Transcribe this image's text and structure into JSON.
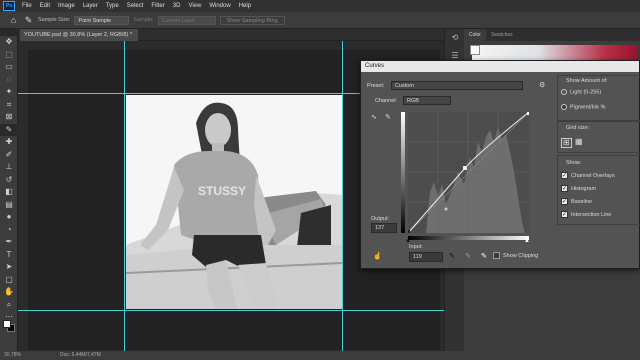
{
  "menubar": {
    "logo": "Ps",
    "items": [
      "File",
      "Edit",
      "Image",
      "Layer",
      "Type",
      "Select",
      "Filter",
      "3D",
      "View",
      "Window",
      "Help"
    ]
  },
  "options": {
    "sample_size_label": "Sample Size:",
    "sample_size_value": "Point Sample",
    "sample_label": "Sample:",
    "sample_value": "Current Layer",
    "show_ring": "Show Sampling Ring"
  },
  "document": {
    "tab_title": "YOUTUBE.psd @ 30,8% (Layer 2, RGB/8) *",
    "close": "×"
  },
  "status": {
    "zoom": "30,78%",
    "doc": "Doc: 6,44M/7,47M"
  },
  "panels": {
    "tabs": [
      "Color",
      "Swatches"
    ]
  },
  "curves": {
    "title": "Curves",
    "preset_label": "Preset:",
    "preset_value": "Custom",
    "channel_label": "Channel:",
    "channel_value": "RGB",
    "output_label": "Output:",
    "output_value": "137",
    "input_label": "Input:",
    "input_value": "119",
    "show_clipping": "Show Clipping",
    "show_amount_label": "Show Amount of:",
    "light_option": "Light  (0-255)",
    "pigment_option": "Pigment/Ink %",
    "grid_size_label": "Grid size:",
    "show_label": "Show:",
    "show_options": [
      "Channel Overlays",
      "Histogram",
      "Baseline",
      "Intersection Line"
    ]
  },
  "icons": {
    "toolbar": [
      "move-icon",
      "artboard-icon",
      "marquee-icon",
      "lasso-icon",
      "quick-select-icon",
      "crop-icon",
      "frame-icon",
      "eyedropper-icon",
      "healing-icon",
      "brush-icon",
      "stamp-icon",
      "history-brush-icon",
      "eraser-icon",
      "gradient-icon",
      "blur-icon",
      "dodge-icon",
      "pen-icon",
      "type-icon",
      "path-select-icon",
      "shape-icon",
      "hand-icon",
      "zoom-icon",
      "more-icon"
    ]
  }
}
